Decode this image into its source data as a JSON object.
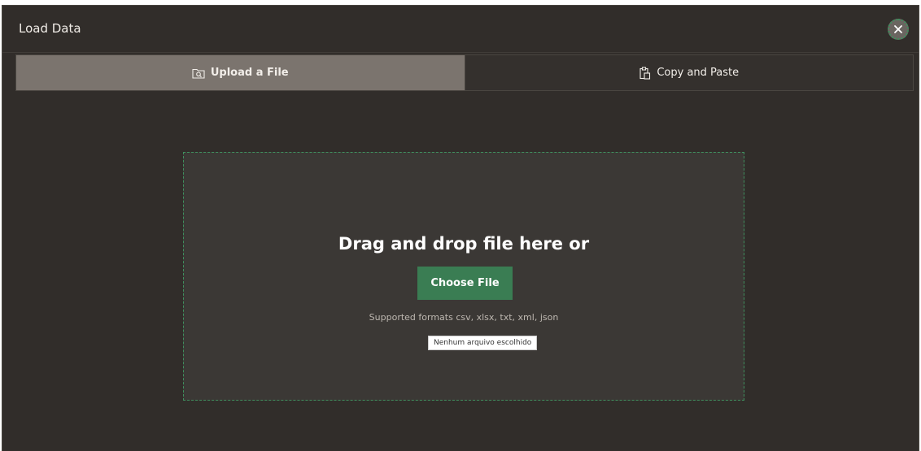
{
  "dialog": {
    "title": "Load Data",
    "close_icon": "close-icon"
  },
  "tabs": [
    {
      "label": "Upload a File",
      "icon": "folder-search-icon",
      "active": true
    },
    {
      "label": "Copy and Paste",
      "icon": "clipboard-icon",
      "active": false
    }
  ],
  "dropzone": {
    "heading": "Drag and drop file here or",
    "button_label": "Choose File",
    "formats_text": "Supported formats csv, xlsx, txt, xml, json",
    "file_status": "Nenhum arquivo escolhido"
  },
  "colors": {
    "background": "#312d2a",
    "active_tab": "#7b746e",
    "accent_green": "#3a7d53",
    "dropzone_border": "#3f8f5e"
  }
}
